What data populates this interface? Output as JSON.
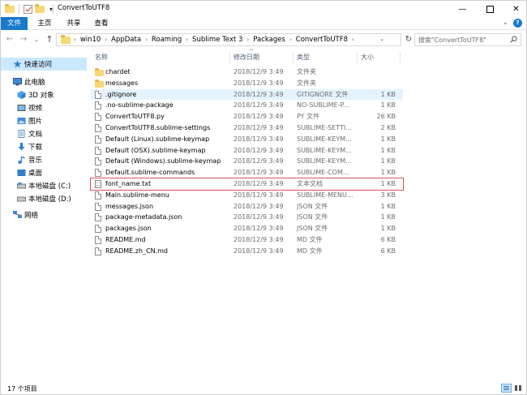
{
  "window": {
    "title": "ConvertToUTF8",
    "minimize_label": "—",
    "close_label": "✕"
  },
  "ribbon": {
    "tabs": [
      {
        "label": "文件",
        "active": true
      },
      {
        "label": "主页"
      },
      {
        "label": "共享"
      },
      {
        "label": "查看"
      }
    ],
    "expand_glyph": "⌄",
    "help_glyph": "?"
  },
  "address_bar": {
    "back_glyph": "←",
    "forward_glyph": "→",
    "recent_glyph": "⌄",
    "up_glyph": "↑",
    "breadcrumbs": [
      "win10",
      "AppData",
      "Roaming",
      "Sublime Text 3",
      "Packages",
      "ConvertToUTF8"
    ],
    "separator": "›",
    "dropdown_glyph": "⌄",
    "refresh_glyph": "↻",
    "search_placeholder": "搜索\"ConvertToUTF8\""
  },
  "sidebar": {
    "items": [
      {
        "label": "快速访问",
        "icon": "star-icon",
        "selected": true
      },
      {
        "label": "此电脑",
        "icon": "computer-icon"
      },
      {
        "label": "3D 对象",
        "icon": "3d-objects-icon"
      },
      {
        "label": "视频",
        "icon": "video-icon"
      },
      {
        "label": "图片",
        "icon": "pictures-icon"
      },
      {
        "label": "文档",
        "icon": "documents-icon"
      },
      {
        "label": "下载",
        "icon": "download-icon"
      },
      {
        "label": "音乐",
        "icon": "music-icon"
      },
      {
        "label": "桌面",
        "icon": "desktop-icon"
      },
      {
        "label": "本地磁盘 (C:)",
        "icon": "drive-icon"
      },
      {
        "label": "本地磁盘 (D:)",
        "icon": "drive-icon"
      },
      {
        "label": "网络",
        "icon": "network-icon"
      }
    ]
  },
  "columns": {
    "name": "名称",
    "date": "修改日期",
    "type": "类型",
    "size": "大小",
    "sort_glyph": "^"
  },
  "files": [
    {
      "name": "chardet",
      "date": "2018/12/9 3:49",
      "type": "文件夹",
      "size": "",
      "icon": "folder-icon"
    },
    {
      "name": "messages",
      "date": "2018/12/9 3:49",
      "type": "文件夹",
      "size": "",
      "icon": "folder-icon"
    },
    {
      "name": ".gitignore",
      "date": "2018/12/9 3:49",
      "type": "GITIGNORE 文件",
      "size": "1 KB",
      "icon": "file-icon",
      "selected": true
    },
    {
      "name": ".no-sublime-package",
      "date": "2018/12/9 3:49",
      "type": "NO-SUBLIME-P...",
      "size": "1 KB",
      "icon": "file-icon"
    },
    {
      "name": "ConvertToUTF8.py",
      "date": "2018/12/9 3:49",
      "type": "PY 文件",
      "size": "26 KB",
      "icon": "file-icon"
    },
    {
      "name": "ConvertToUTF8.sublime-settings",
      "date": "2018/12/9 3:49",
      "type": "SUBLIME-SETTI...",
      "size": "2 KB",
      "icon": "file-icon"
    },
    {
      "name": "Default (Linux).sublime-keymap",
      "date": "2018/12/9 3:49",
      "type": "SUBLIME-KEYM...",
      "size": "1 KB",
      "icon": "file-icon"
    },
    {
      "name": "Default (OSX).sublime-keymap",
      "date": "2018/12/9 3:49",
      "type": "SUBLIME-KEYM...",
      "size": "1 KB",
      "icon": "file-icon"
    },
    {
      "name": "Default (Windows).sublime-keymap",
      "date": "2018/12/9 3:49",
      "type": "SUBLIME-KEYM...",
      "size": "1 KB",
      "icon": "file-icon"
    },
    {
      "name": "Default.sublime-commands",
      "date": "2018/12/9 3:49",
      "type": "SUBLIME-COM...",
      "size": "1 KB",
      "icon": "file-icon"
    },
    {
      "name": "font_name.txt",
      "date": "2018/12/9 3:49",
      "type": "文本文档",
      "size": "1 KB",
      "icon": "text-file-icon",
      "highlighted": true
    },
    {
      "name": "Main.sublime-menu",
      "date": "2018/12/9 3:49",
      "type": "SUBLIME-MENU...",
      "size": "3 KB",
      "icon": "file-icon"
    },
    {
      "name": "messages.json",
      "date": "2018/12/9 3:49",
      "type": "JSON 文件",
      "size": "1 KB",
      "icon": "file-icon"
    },
    {
      "name": "package-metadata.json",
      "date": "2018/12/9 3:49",
      "type": "JSON 文件",
      "size": "1 KB",
      "icon": "file-icon"
    },
    {
      "name": "packages.json",
      "date": "2018/12/9 3:49",
      "type": "JSON 文件",
      "size": "1 KB",
      "icon": "file-icon"
    },
    {
      "name": "README.md",
      "date": "2018/12/9 3:49",
      "type": "MD 文件",
      "size": "6 KB",
      "icon": "file-icon"
    },
    {
      "name": "README.zh_CN.md",
      "date": "2018/12/9 3:49",
      "type": "MD 文件",
      "size": "6 KB",
      "icon": "file-icon"
    }
  ],
  "status": {
    "item_count": "17 个项目"
  },
  "colors": {
    "accent": "#1979ca",
    "selection": "#cce8ff",
    "highlight_box": "#e0515b",
    "folder": "#f8d775"
  }
}
